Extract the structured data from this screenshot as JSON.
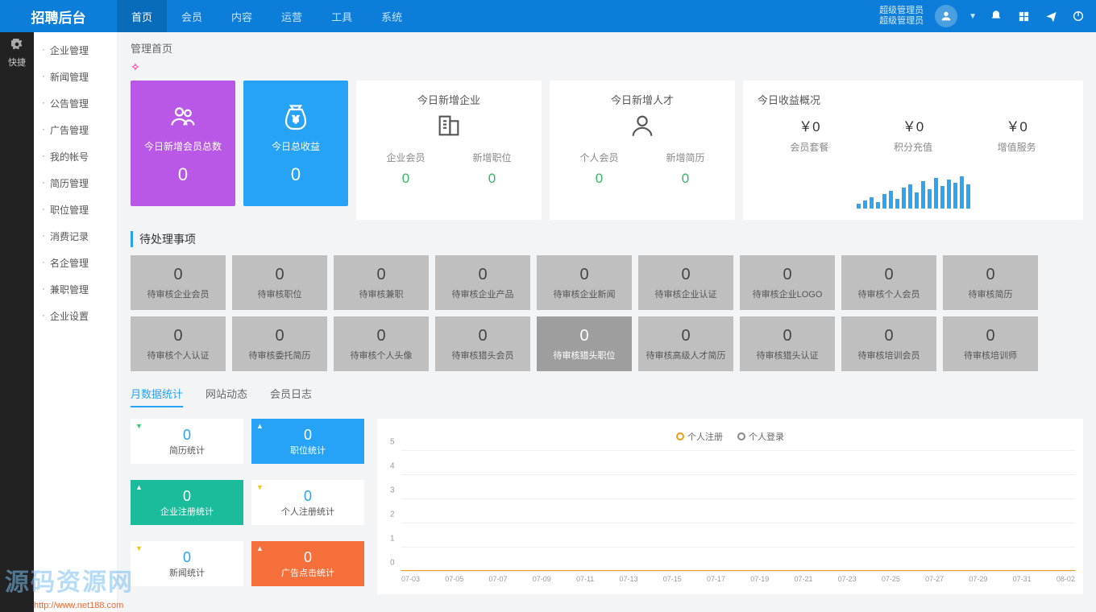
{
  "brand": "招聘后台",
  "topnav": [
    "首页",
    "会员",
    "内容",
    "运营",
    "工具",
    "系统"
  ],
  "topnav_active": 0,
  "user": {
    "line1": "超级管理员",
    "line2": "超级管理员"
  },
  "quick_label": "快捷",
  "sidebar": [
    "企业管理",
    "新闻管理",
    "公告管理",
    "广告管理",
    "我的帐号",
    "简历管理",
    "职位管理",
    "消费记录",
    "名企管理",
    "兼职管理",
    "企业设置"
  ],
  "breadcrumb": "管理首页",
  "tiles": [
    {
      "label": "今日新增会员总数",
      "value": "0",
      "color": "purple"
    },
    {
      "label": "今日总收益",
      "value": "0",
      "color": "blue"
    }
  ],
  "panel_enterprise": {
    "title": "今日新增企业",
    "sub": [
      {
        "l": "企业会员",
        "v": "0"
      },
      {
        "l": "新增职位",
        "v": "0"
      }
    ]
  },
  "panel_person": {
    "title": "今日新增人才",
    "sub": [
      {
        "l": "个人会员",
        "v": "0"
      },
      {
        "l": "新增简历",
        "v": "0"
      }
    ]
  },
  "revenue": {
    "title": "今日收益概况",
    "items": [
      {
        "amt": "￥0",
        "lbl": "会员套餐"
      },
      {
        "amt": "￥0",
        "lbl": "积分充值"
      },
      {
        "amt": "￥0",
        "lbl": "增值服务"
      }
    ]
  },
  "pending_title": "待处理事项",
  "pending": [
    {
      "n": "0",
      "l": "待审核企业会员"
    },
    {
      "n": "0",
      "l": "待审核职位"
    },
    {
      "n": "0",
      "l": "待审核兼职"
    },
    {
      "n": "0",
      "l": "待审核企业产品"
    },
    {
      "n": "0",
      "l": "待审核企业新闻"
    },
    {
      "n": "0",
      "l": "待审核企业认证"
    },
    {
      "n": "0",
      "l": "待审核企业LOGO"
    },
    {
      "n": "0",
      "l": "待审核个人会员"
    },
    {
      "n": "0",
      "l": "待审核简历"
    },
    {
      "n": "0",
      "l": "待审核个人认证"
    },
    {
      "n": "0",
      "l": "待审核委托简历"
    },
    {
      "n": "0",
      "l": "待审核个人头像"
    },
    {
      "n": "0",
      "l": "待审核猎头会员"
    },
    {
      "n": "0",
      "l": "待审核猎头职位",
      "hl": true
    },
    {
      "n": "0",
      "l": "待审核高级人才简历"
    },
    {
      "n": "0",
      "l": "待审核猎头认证"
    },
    {
      "n": "0",
      "l": "待审核培训会员"
    },
    {
      "n": "0",
      "l": "待审核培训师"
    }
  ],
  "tabs": [
    "月数据统计",
    "网站动态",
    "会员日志"
  ],
  "tabs_active": 0,
  "stats": [
    {
      "n": "0",
      "l": "简历统计",
      "cls": "white",
      "tri": "▼",
      "tc": "#2ecc71"
    },
    {
      "n": "0",
      "l": "职位统计",
      "cls": "blue",
      "tri": "▲",
      "tc": "#fff"
    },
    {
      "n": "0",
      "l": "企业注册统计",
      "cls": "teal",
      "tri": "▲",
      "tc": "#fff"
    },
    {
      "n": "0",
      "l": "个人注册统计",
      "cls": "white",
      "tri": "▼",
      "tc": "#f1c40f"
    },
    {
      "n": "0",
      "l": "新闻统计",
      "cls": "white",
      "tri": "▼",
      "tc": "#f1c40f"
    },
    {
      "n": "0",
      "l": "广告点击统计",
      "cls": "orange",
      "tri": "▲",
      "tc": "#fff"
    }
  ],
  "chart": {
    "legend": [
      "个人注册",
      "个人登录"
    ],
    "ymax": 5,
    "xticks": [
      "07-03",
      "07-05",
      "07-07",
      "07-09",
      "07-11",
      "07-13",
      "07-15",
      "07-17",
      "07-19",
      "07-21",
      "07-23",
      "07-25",
      "07-27",
      "07-29",
      "07-31",
      "08-02"
    ]
  },
  "chart_data": {
    "type": "line",
    "title": "",
    "xlabel": "",
    "ylabel": "",
    "ylim": [
      0,
      5
    ],
    "categories": [
      "07-03",
      "07-05",
      "07-07",
      "07-09",
      "07-11",
      "07-13",
      "07-15",
      "07-17",
      "07-19",
      "07-21",
      "07-23",
      "07-25",
      "07-27",
      "07-29",
      "07-31",
      "08-02"
    ],
    "series": [
      {
        "name": "个人注册",
        "values": [
          0,
          0,
          0,
          0,
          0,
          0,
          0,
          0,
          0,
          0,
          0,
          0,
          0,
          0,
          0,
          0
        ]
      },
      {
        "name": "个人登录",
        "values": [
          0,
          0,
          0,
          0,
          0,
          0,
          0,
          0,
          0,
          0,
          0,
          0,
          0,
          0,
          0,
          0
        ]
      }
    ]
  },
  "spark": [
    6,
    10,
    14,
    8,
    18,
    22,
    12,
    26,
    30,
    20,
    34,
    24,
    38,
    28,
    36,
    32,
    40,
    30
  ],
  "watermark": "源码资源网",
  "wm_url": "http://www.net188.com"
}
